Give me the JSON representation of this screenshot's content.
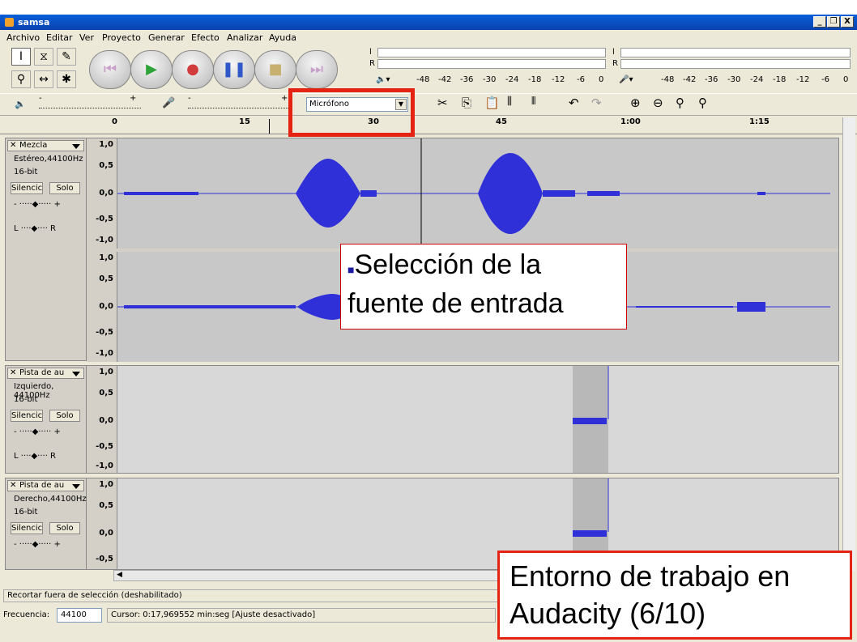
{
  "window": {
    "title": "samsa",
    "min": "_",
    "max": "❐",
    "close": "X"
  },
  "menu": [
    "Archivo",
    "Editar",
    "Ver",
    "Proyecto",
    "Generar",
    "Efecto",
    "Analizar",
    "Ayuda"
  ],
  "meters": {
    "l": "l",
    "r": "R",
    "scale": [
      "-48",
      "-42",
      "-36",
      "-30",
      "-24",
      "-18",
      "-12",
      "-6",
      "0"
    ]
  },
  "input_source": "Micrófono",
  "ruler": [
    "0",
    "15",
    "30",
    "45",
    "1:00",
    "1:15"
  ],
  "tracks": [
    {
      "name": "Mezcla",
      "line1": "Estéreo,44100Hz",
      "line2": "16-bit",
      "mute": "Silencic",
      "solo": "Solo",
      "scale": [
        "1,0",
        "0,5",
        "0,0",
        "-0,5",
        "-1,0"
      ]
    },
    {
      "name": "",
      "scale": [
        "1,0",
        "0,5",
        "0,0",
        "-0,5",
        "-1,0"
      ]
    },
    {
      "name": "Pista de au",
      "line1": "Izquierdo, 44100Hz",
      "line2": "16-bit",
      "mute": "Silencic",
      "solo": "Solo",
      "scale": [
        "1,0",
        "0,5",
        "0,0",
        "-0,5",
        "-1,0"
      ]
    },
    {
      "name": "Pista de au",
      "line1": "Derecho,44100Hz",
      "line2": "16-bit",
      "mute": "Silencic",
      "solo": "Solo",
      "scale": [
        "1,0",
        "0,5",
        "0,0",
        "-0,5"
      ]
    }
  ],
  "slider": {
    "minus": "-",
    "plus": "+",
    "l": "L",
    "r": "R"
  },
  "status": {
    "message": "Recortar fuera de selección (deshabilitado)",
    "freq_label": "Frecuencia:",
    "freq_value": "44100",
    "cursor": "Cursor: 0:17,969552 min:seg   [Ajuste desactivado]"
  },
  "callout": {
    "bullet": "■",
    "text": "Selección de la fuente de entrada"
  },
  "caption": {
    "line1": "Entorno de trabajo en",
    "line2": "Audacity (6/10)"
  },
  "colors": {
    "wave": "#3030d8",
    "wave_light": "#6a6ae8",
    "accent": "#e42313"
  }
}
